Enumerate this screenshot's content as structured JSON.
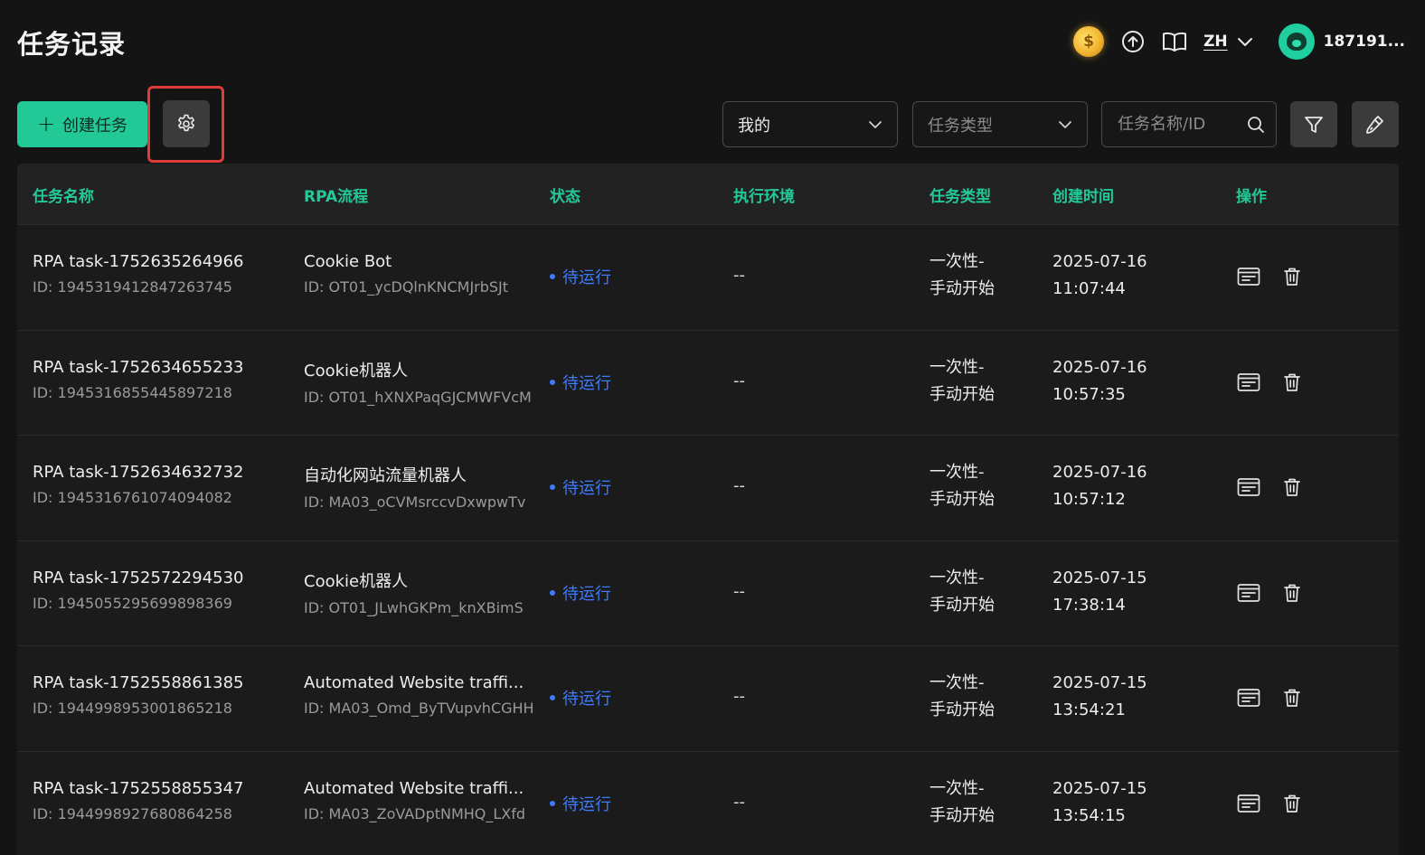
{
  "header": {
    "title": "任务记录",
    "language": "ZH",
    "user_name": "187191..."
  },
  "toolbar": {
    "create_label": "创建任务",
    "owner_filter": "我的",
    "type_filter_placeholder": "任务类型",
    "search_placeholder": "任务名称/ID"
  },
  "table": {
    "columns": [
      "任务名称",
      "RPA流程",
      "状态",
      "执行环境",
      "任务类型",
      "创建时间",
      "操作"
    ],
    "rows": [
      {
        "name": "RPA task-1752635264966",
        "id": "ID: 1945319412847263745",
        "flow": "Cookie Bot",
        "flow_id": "ID: OT01_ycDQlnKNCMJrbSJt",
        "status": "待运行",
        "env": "--",
        "type1": "一次性-",
        "type2": "手动开始",
        "date": "2025-07-16",
        "time": "11:07:44"
      },
      {
        "name": "RPA task-1752634655233",
        "id": "ID: 1945316855445897218",
        "flow": "Cookie机器人",
        "flow_id": "ID: OT01_hXNXPaqGJCMWFVcM",
        "status": "待运行",
        "env": "--",
        "type1": "一次性-",
        "type2": "手动开始",
        "date": "2025-07-16",
        "time": "10:57:35"
      },
      {
        "name": "RPA task-1752634632732",
        "id": "ID: 1945316761074094082",
        "flow": "自动化网站流量机器人",
        "flow_id": "ID: MA03_oCVMsrccvDxwpwTv",
        "status": "待运行",
        "env": "--",
        "type1": "一次性-",
        "type2": "手动开始",
        "date": "2025-07-16",
        "time": "10:57:12"
      },
      {
        "name": "RPA task-1752572294530",
        "id": "ID: 1945055295699898369",
        "flow": "Cookie机器人",
        "flow_id": "ID: OT01_JLwhGKPm_knXBimS",
        "status": "待运行",
        "env": "--",
        "type1": "一次性-",
        "type2": "手动开始",
        "date": "2025-07-15",
        "time": "17:38:14"
      },
      {
        "name": "RPA task-1752558861385",
        "id": "ID: 1944998953001865218",
        "flow": "Automated Website traffi...",
        "flow_id": "ID: MA03_Omd_ByTVupvhCGHH",
        "status": "待运行",
        "env": "--",
        "type1": "一次性-",
        "type2": "手动开始",
        "date": "2025-07-15",
        "time": "13:54:21"
      },
      {
        "name": "RPA task-1752558855347",
        "id": "ID: 1944998927680864258",
        "flow": "Automated Website traffi...",
        "flow_id": "ID: MA03_ZoVADptNMHQ_LXfd",
        "status": "待运行",
        "env": "--",
        "type1": "一次性-",
        "type2": "手动开始",
        "date": "2025-07-15",
        "time": "13:54:15"
      }
    ]
  },
  "colors": {
    "accent": "#22c997",
    "status_pending": "#3d7bff",
    "highlight_box": "#e03b3b",
    "background": "#141414"
  },
  "icons": {
    "coin": "coin-icon",
    "upload": "upload-icon",
    "docs": "book-icon",
    "settings": "gear-icon",
    "filter": "funnel-icon",
    "clear": "broom-icon",
    "log": "log-icon",
    "delete": "trash-icon"
  }
}
